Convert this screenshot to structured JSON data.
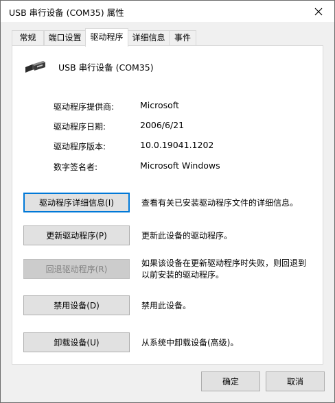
{
  "window": {
    "title": "USB 串行设备 (COM35) 属性"
  },
  "tabs": [
    {
      "label": "常规"
    },
    {
      "label": "端口设置"
    },
    {
      "label": "驱动程序",
      "active": true
    },
    {
      "label": "详细信息"
    },
    {
      "label": "事件"
    }
  ],
  "device": {
    "name": "USB 串行设备 (COM35)",
    "icon": "usb-connector-icon"
  },
  "info": [
    {
      "label": "驱动程序提供商:",
      "value": "Microsoft"
    },
    {
      "label": "驱动程序日期:",
      "value": "2006/6/21"
    },
    {
      "label": "驱动程序版本:",
      "value": "10.0.19041.1202"
    },
    {
      "label": "数字签名者:",
      "value": "Microsoft Windows"
    }
  ],
  "actions": [
    {
      "label": "驱动程序详细信息(I)",
      "desc": "查看有关已安装驱动程序文件的详细信息。",
      "state": "focused"
    },
    {
      "label": "更新驱动程序(P)",
      "desc": "更新此设备的驱动程序。",
      "state": "normal"
    },
    {
      "label": "回退驱动程序(R)",
      "desc": "如果该设备在更新驱动程序时失败，则回退到以前安装的驱动程序。",
      "state": "disabled"
    },
    {
      "label": "禁用设备(D)",
      "desc": "禁用此设备。",
      "state": "normal"
    },
    {
      "label": "卸载设备(U)",
      "desc": "从系统中卸载设备(高级)。",
      "state": "normal"
    }
  ],
  "footer": {
    "ok_label": "确定",
    "cancel_label": "取消"
  },
  "colors": {
    "focus_border": "#0078d7",
    "button_face": "#e1e1e1",
    "disabled_text": "#838383"
  }
}
